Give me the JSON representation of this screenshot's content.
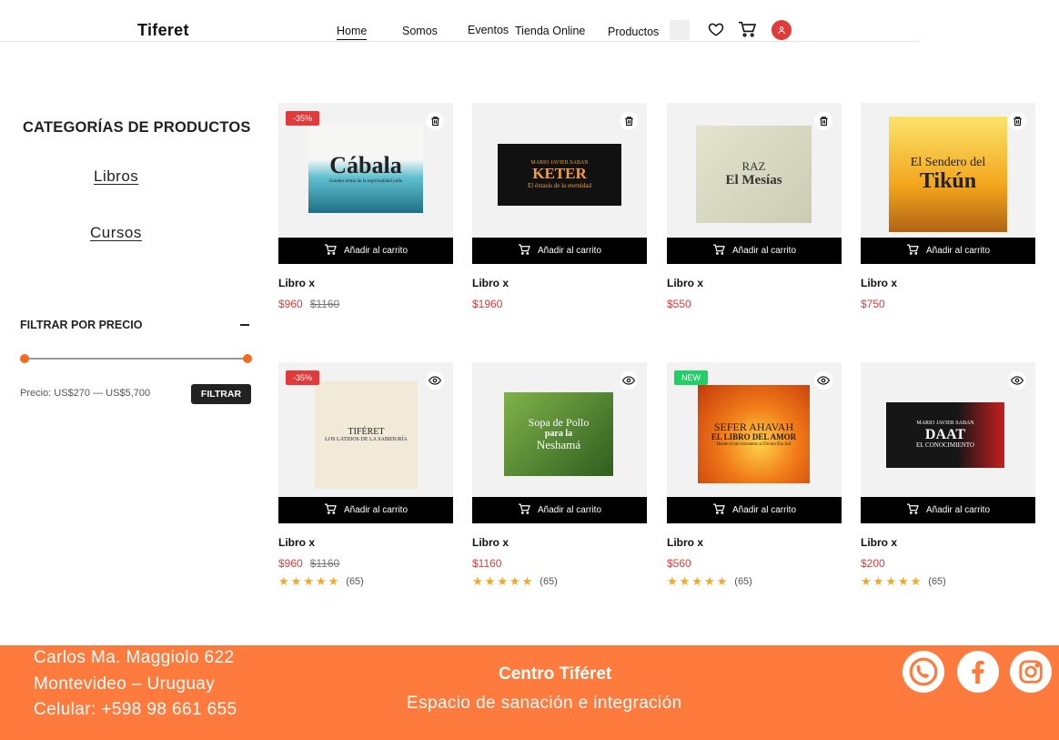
{
  "header": {
    "brand": "Tiferet",
    "nav": [
      "Home",
      "Somos",
      "Eventos",
      "Tienda Online",
      "Productos"
    ],
    "icons": [
      "search-box",
      "heart-icon",
      "cart-icon",
      "user-icon"
    ]
  },
  "sidebar": {
    "categories_title": "CATEGORÍAS DE PRODUCTOS",
    "categories": [
      "Libros",
      "Cursos"
    ],
    "filter_title": "FILTRAR POR PRECIO",
    "price_range_label": "Precio: US$270 — US$5,700",
    "filter_button": "FILTRAR"
  },
  "products": [
    {
      "name": "Libro x",
      "price": "$960",
      "old_price": "$1160",
      "badge": "-35%",
      "action_icon": "trash-icon",
      "cart_label": "Añadir al carrito",
      "cover": {
        "line1": "",
        "line2": "Cábala",
        "line3": "Grandes temas de la espiritualidad judía"
      }
    },
    {
      "name": "Libro x",
      "price": "$1960",
      "old_price": "",
      "badge": "",
      "action_icon": "trash-icon",
      "cart_label": "Añadir al carrito",
      "cover": {
        "line1": "MARIO JAVIER SABAN",
        "line2": "KETER",
        "line3": "El éxtasis de la eternidad"
      }
    },
    {
      "name": "Libro x",
      "price": "$550",
      "old_price": "",
      "badge": "",
      "action_icon": "trash-icon",
      "cart_label": "Añadir al carrito",
      "cover": {
        "line1": "RAZ",
        "line2": "El Mesías",
        "line3": ""
      }
    },
    {
      "name": "Libro x",
      "price": "$750",
      "old_price": "",
      "badge": "",
      "action_icon": "trash-icon",
      "cart_label": "Añadir al carrito",
      "cover": {
        "line1": "El Sendero del",
        "line2": "Tikún",
        "line3": ""
      }
    },
    {
      "name": "Libro x",
      "price": "$960",
      "old_price": "$1160",
      "badge": "-35%",
      "action_icon": "eye-icon",
      "cart_label": "Añadir al carrito",
      "rating": 5,
      "reviews": "(65)",
      "cover": {
        "line1": "TIFÉRET",
        "line2": "",
        "line3": "LOS LATIDOS DE LA SABIDURÍA"
      }
    },
    {
      "name": "Libro x",
      "price": "$1160",
      "old_price": "",
      "badge": "",
      "action_icon": "eye-icon",
      "cart_label": "Añadir al carrito",
      "rating": 5,
      "reviews": "(65)",
      "cover": {
        "line1": "Sopa de Pollo",
        "line2": "para la",
        "line3": "Neshamá"
      }
    },
    {
      "name": "Libro x",
      "price": "$560",
      "old_price": "",
      "badge": "NEW",
      "action_icon": "eye-icon",
      "cart_label": "Añadir al carrito",
      "rating": 5,
      "reviews": "(65)",
      "cover": {
        "line1": "SEFER AHAVAH",
        "line2": "EL LIBRO DEL AMOR",
        "line3": "Desde el microcosmos al Divino Ein Sof"
      }
    },
    {
      "name": "Libro x",
      "price": "$200",
      "old_price": "",
      "badge": "",
      "action_icon": "eye-icon",
      "cart_label": "Añadir al carrito",
      "rating": 5,
      "reviews": "(65)",
      "cover": {
        "line1": "MARIO JAVIER SABAN",
        "line2": "DAAT",
        "line3": "EL CONOCIMIENTO"
      }
    }
  ],
  "footer": {
    "address": [
      "Carlos Ma. Maggiolo 622",
      "Montevideo – Uruguay",
      "Celular: +598 98 661 655"
    ],
    "title": "Centro Tiféret",
    "subtitle": "Espacio de sanación e integración",
    "social": [
      "whatsapp-icon",
      "facebook-icon",
      "instagram-icon"
    ]
  },
  "colors": {
    "accent": "#ff7a3d",
    "price": "#e03a3a",
    "new_badge": "#22cf66",
    "star": "#f5a623"
  }
}
